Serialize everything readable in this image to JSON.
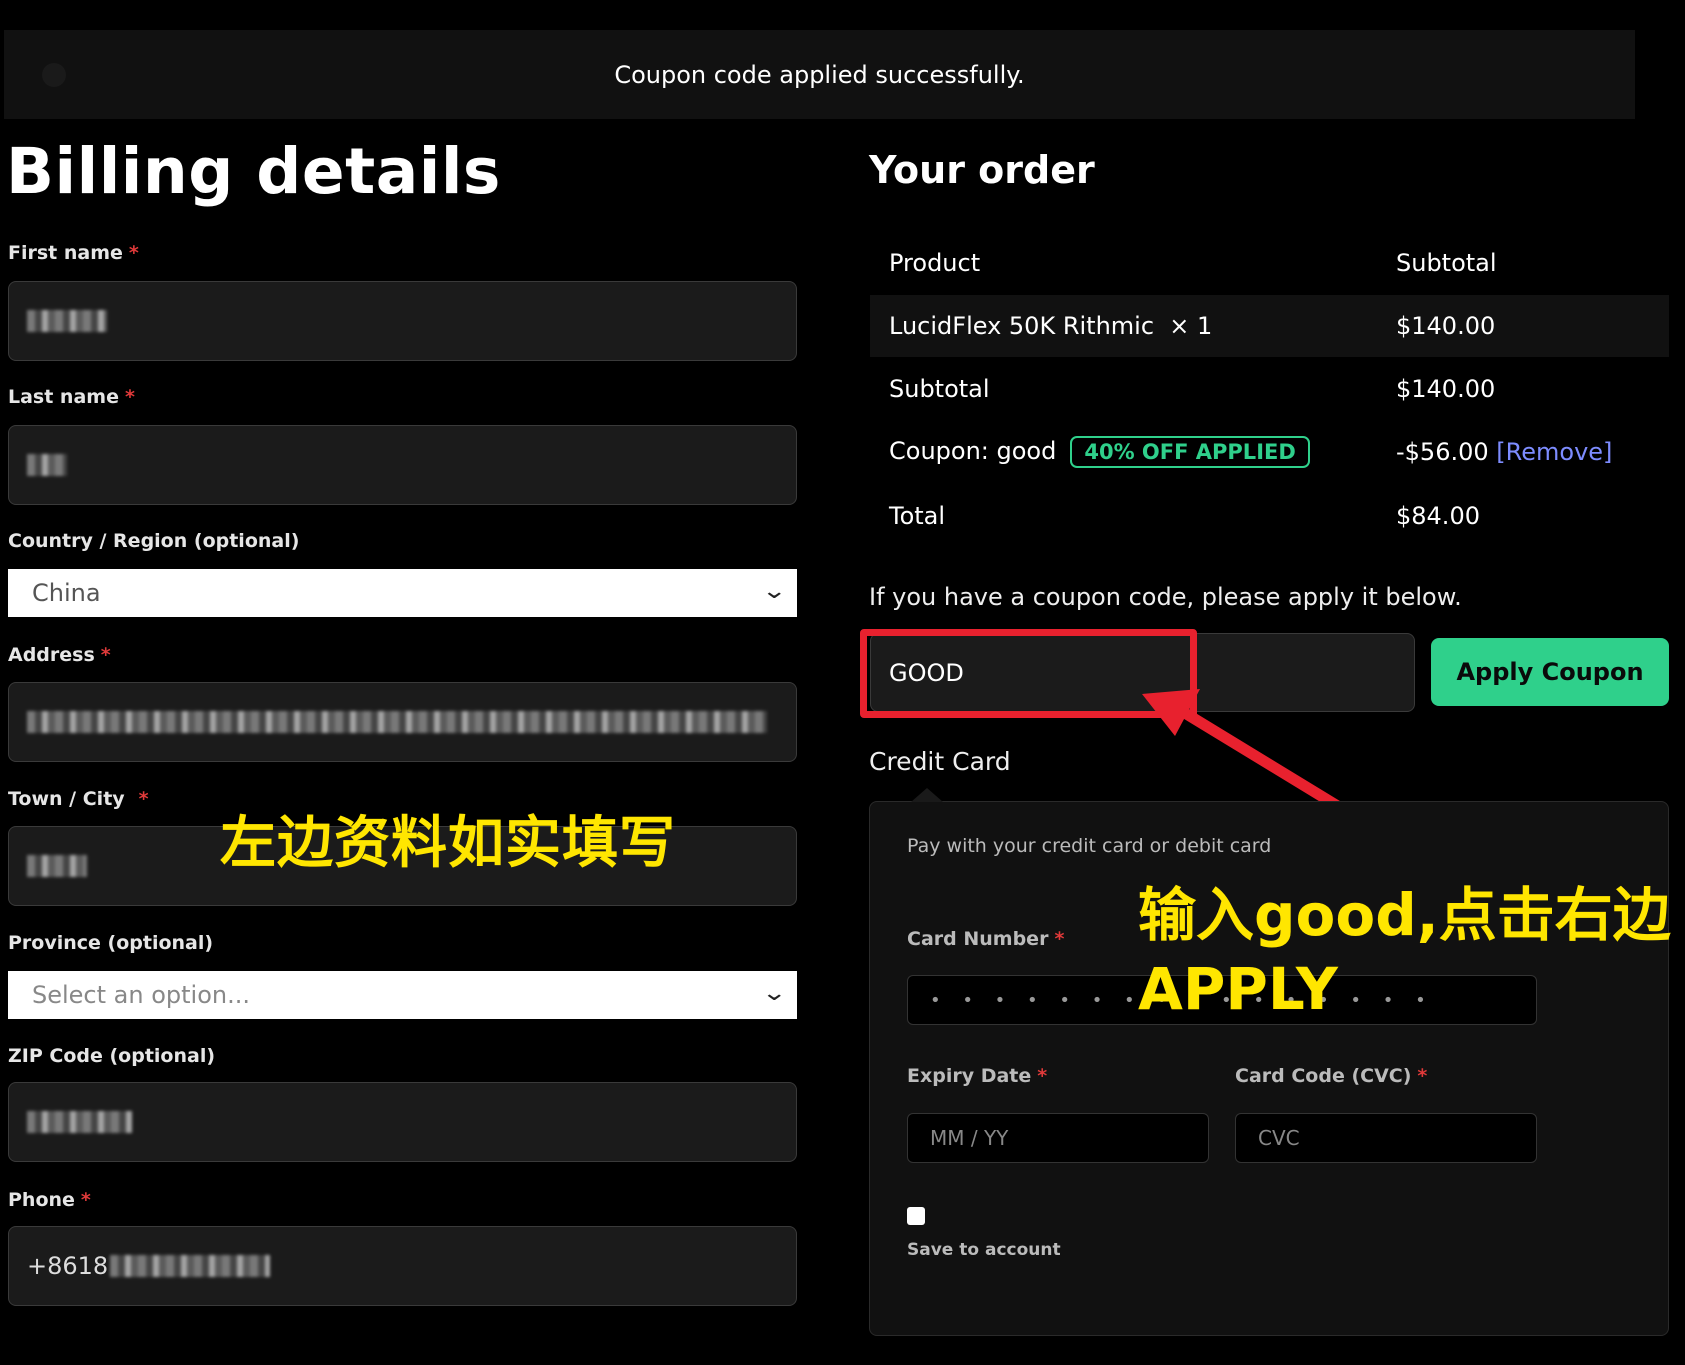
{
  "notice": {
    "message": "Coupon code applied successfully."
  },
  "billing": {
    "title": "Billing details",
    "required_mark": "*",
    "first_name": {
      "label": "First name"
    },
    "last_name": {
      "label": "Last name"
    },
    "country": {
      "label": "Country / Region (optional)",
      "value": "China"
    },
    "address": {
      "label": "Address"
    },
    "town": {
      "label": "Town / City"
    },
    "province": {
      "label": "Province (optional)",
      "placeholder": "Select an option..."
    },
    "zip": {
      "label": "ZIP Code (optional)"
    },
    "phone": {
      "label": "Phone",
      "visible_prefix": "+8618"
    }
  },
  "order": {
    "title": "Your order",
    "header": {
      "product": "Product",
      "subtotal": "Subtotal"
    },
    "item": {
      "name": "LucidFlex 50K Rithmic",
      "qty": "× 1",
      "price": "$140.00"
    },
    "subtotal": {
      "label": "Subtotal",
      "value": "$140.00"
    },
    "coupon": {
      "label": "Coupon: good",
      "badge": "40% OFF APPLIED",
      "value": "-$56.00",
      "remove": "[Remove]"
    },
    "total": {
      "label": "Total",
      "value": "$84.00"
    }
  },
  "coupon_form": {
    "prompt": "If you have a coupon code, please apply it below.",
    "value": "GOOD",
    "button": "Apply Coupon"
  },
  "credit_card": {
    "title": "Credit Card",
    "description": "Pay with your credit card or debit card",
    "card_number": {
      "label": "Card Number",
      "mask": "• • • • • • • • • • • • • • • •"
    },
    "expiry": {
      "label": "Expiry Date",
      "placeholder": "MM / YY"
    },
    "cvc": {
      "label": "Card Code (CVC)",
      "placeholder": "CVC"
    },
    "save": {
      "label": "Save to account"
    }
  },
  "annotations": {
    "left": "左边资料如实填写",
    "right_line1": "输入good,点击右边",
    "right_line2": "APPLY"
  },
  "colors": {
    "accent_green": "#2fd08b",
    "annotation_yellow": "#ffe600",
    "annotation_red": "#e8212e",
    "required_red": "#e03a3a",
    "link_blue": "#7d8cff"
  }
}
